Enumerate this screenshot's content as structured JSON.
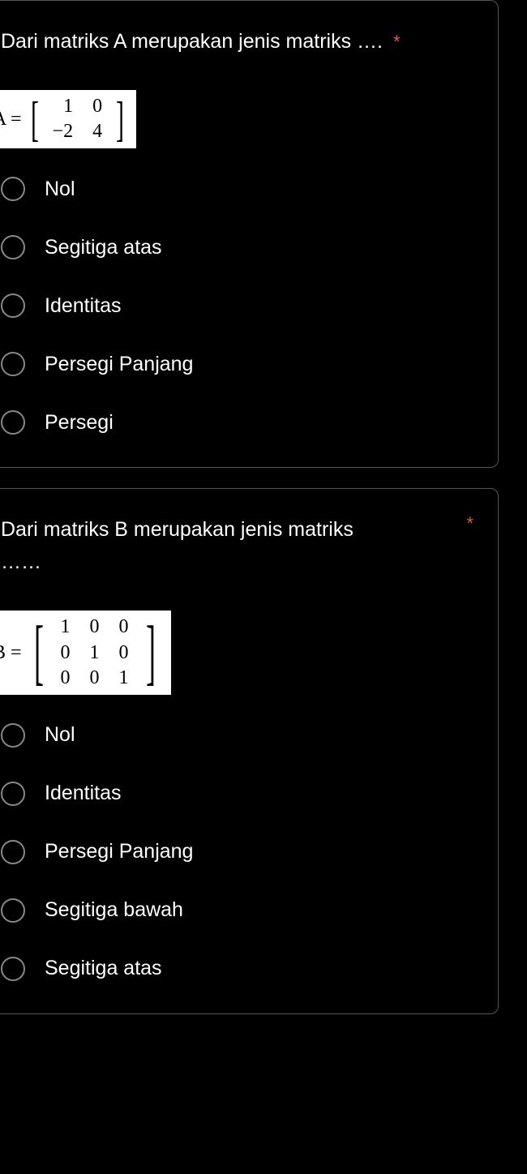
{
  "questions": [
    {
      "text": "Dari matriks A  merupakan jenis matriks ….",
      "required_marker": "*",
      "matrix_label": "A =",
      "matrix_rows": [
        [
          "1",
          "0"
        ],
        [
          "−2",
          "4"
        ]
      ],
      "options": [
        "Nol",
        "Segitiga atas",
        "Identitas",
        "Persegi Panjang",
        "Persegi"
      ]
    },
    {
      "text": "Dari matriks B   merupakan jenis matriks ……",
      "required_marker": "*",
      "matrix_label": "B =",
      "matrix_rows": [
        [
          "1",
          "0",
          "0"
        ],
        [
          "0",
          "1",
          "0"
        ],
        [
          "0",
          "0",
          "1"
        ]
      ],
      "options": [
        "Nol",
        "Identitas",
        "Persegi Panjang",
        "Segitiga bawah",
        "Segitiga atas"
      ]
    }
  ]
}
